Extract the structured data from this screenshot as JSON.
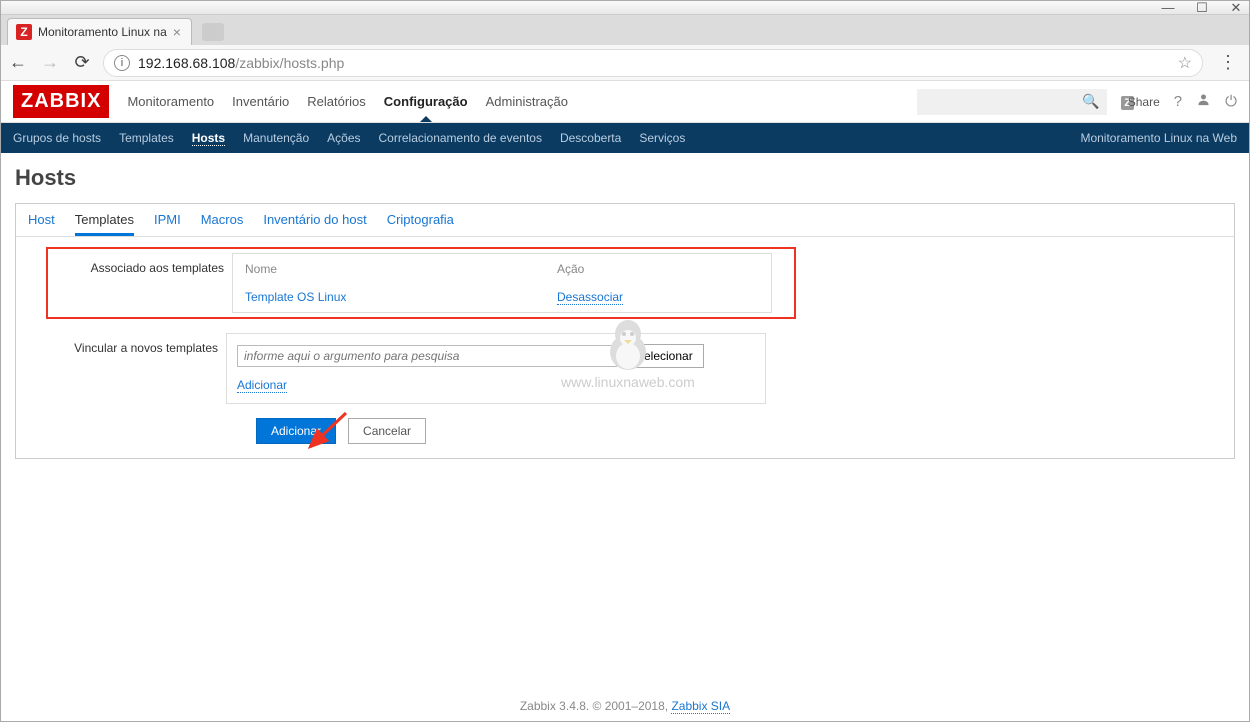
{
  "window": {
    "tab_title": "Monitoramento Linux na"
  },
  "browser": {
    "url_host": "192.168.68.108",
    "url_path": "/zabbix/hosts.php",
    "favicon_letter": "Z"
  },
  "header": {
    "logo": "ZABBIX",
    "nav": [
      "Monitoramento",
      "Inventário",
      "Relatórios",
      "Configuração",
      "Administração"
    ],
    "nav_active_index": 3,
    "share_badge": "Z",
    "share_text": "Share"
  },
  "subnav": {
    "items": [
      "Grupos de hosts",
      "Templates",
      "Hosts",
      "Manutenção",
      "Ações",
      "Correlacionamento de eventos",
      "Descoberta",
      "Serviços"
    ],
    "active_index": 2,
    "right_text": "Monitoramento Linux na Web"
  },
  "page": {
    "title": "Hosts",
    "tabs": [
      "Host",
      "Templates",
      "IPMI",
      "Macros",
      "Inventário do host",
      "Criptografia"
    ],
    "tabs_active_index": 1,
    "associated": {
      "label": "Associado aos templates",
      "col_name": "Nome",
      "col_action": "Ação",
      "row_name": "Template OS Linux",
      "row_action": "Desassociar"
    },
    "link_new": {
      "label": "Vincular a novos templates",
      "placeholder": "informe aqui o argumento para pesquisa",
      "select_btn": "Selecionar",
      "add_link": "Adicionar"
    },
    "buttons": {
      "add": "Adicionar",
      "cancel": "Cancelar"
    }
  },
  "watermark": "www.linuxnaweb.com",
  "footer": {
    "text_a": "Zabbix 3.4.8. © 2001–2018, ",
    "link": "Zabbix SIA"
  }
}
